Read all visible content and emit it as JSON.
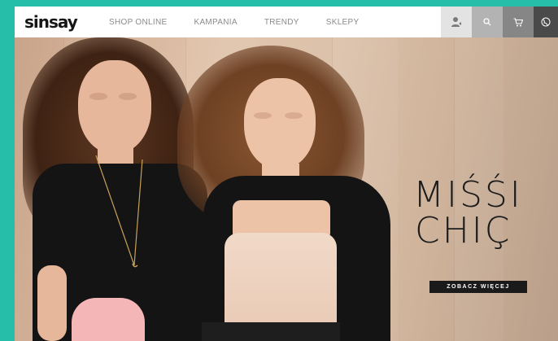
{
  "brand": {
    "logo_text": "sinsay"
  },
  "nav": {
    "items": [
      {
        "label": "SHOP ONLINE"
      },
      {
        "label": "KAMPANIA"
      },
      {
        "label": "TRENDY"
      },
      {
        "label": "SKLEPY"
      }
    ]
  },
  "header_icons": {
    "user": "user-icon",
    "search": "search-icon",
    "cart": "cart-icon",
    "globe": "globe-icon"
  },
  "hero": {
    "title_line1": "MIŚŚI",
    "title_line2": "CHIÇ",
    "cta_label": "ZOBACZ WIĘCEJ"
  },
  "colors": {
    "frame_background": "#26bea8",
    "cta_background": "#1a1a1a",
    "title_color": "#1c1c1c"
  }
}
